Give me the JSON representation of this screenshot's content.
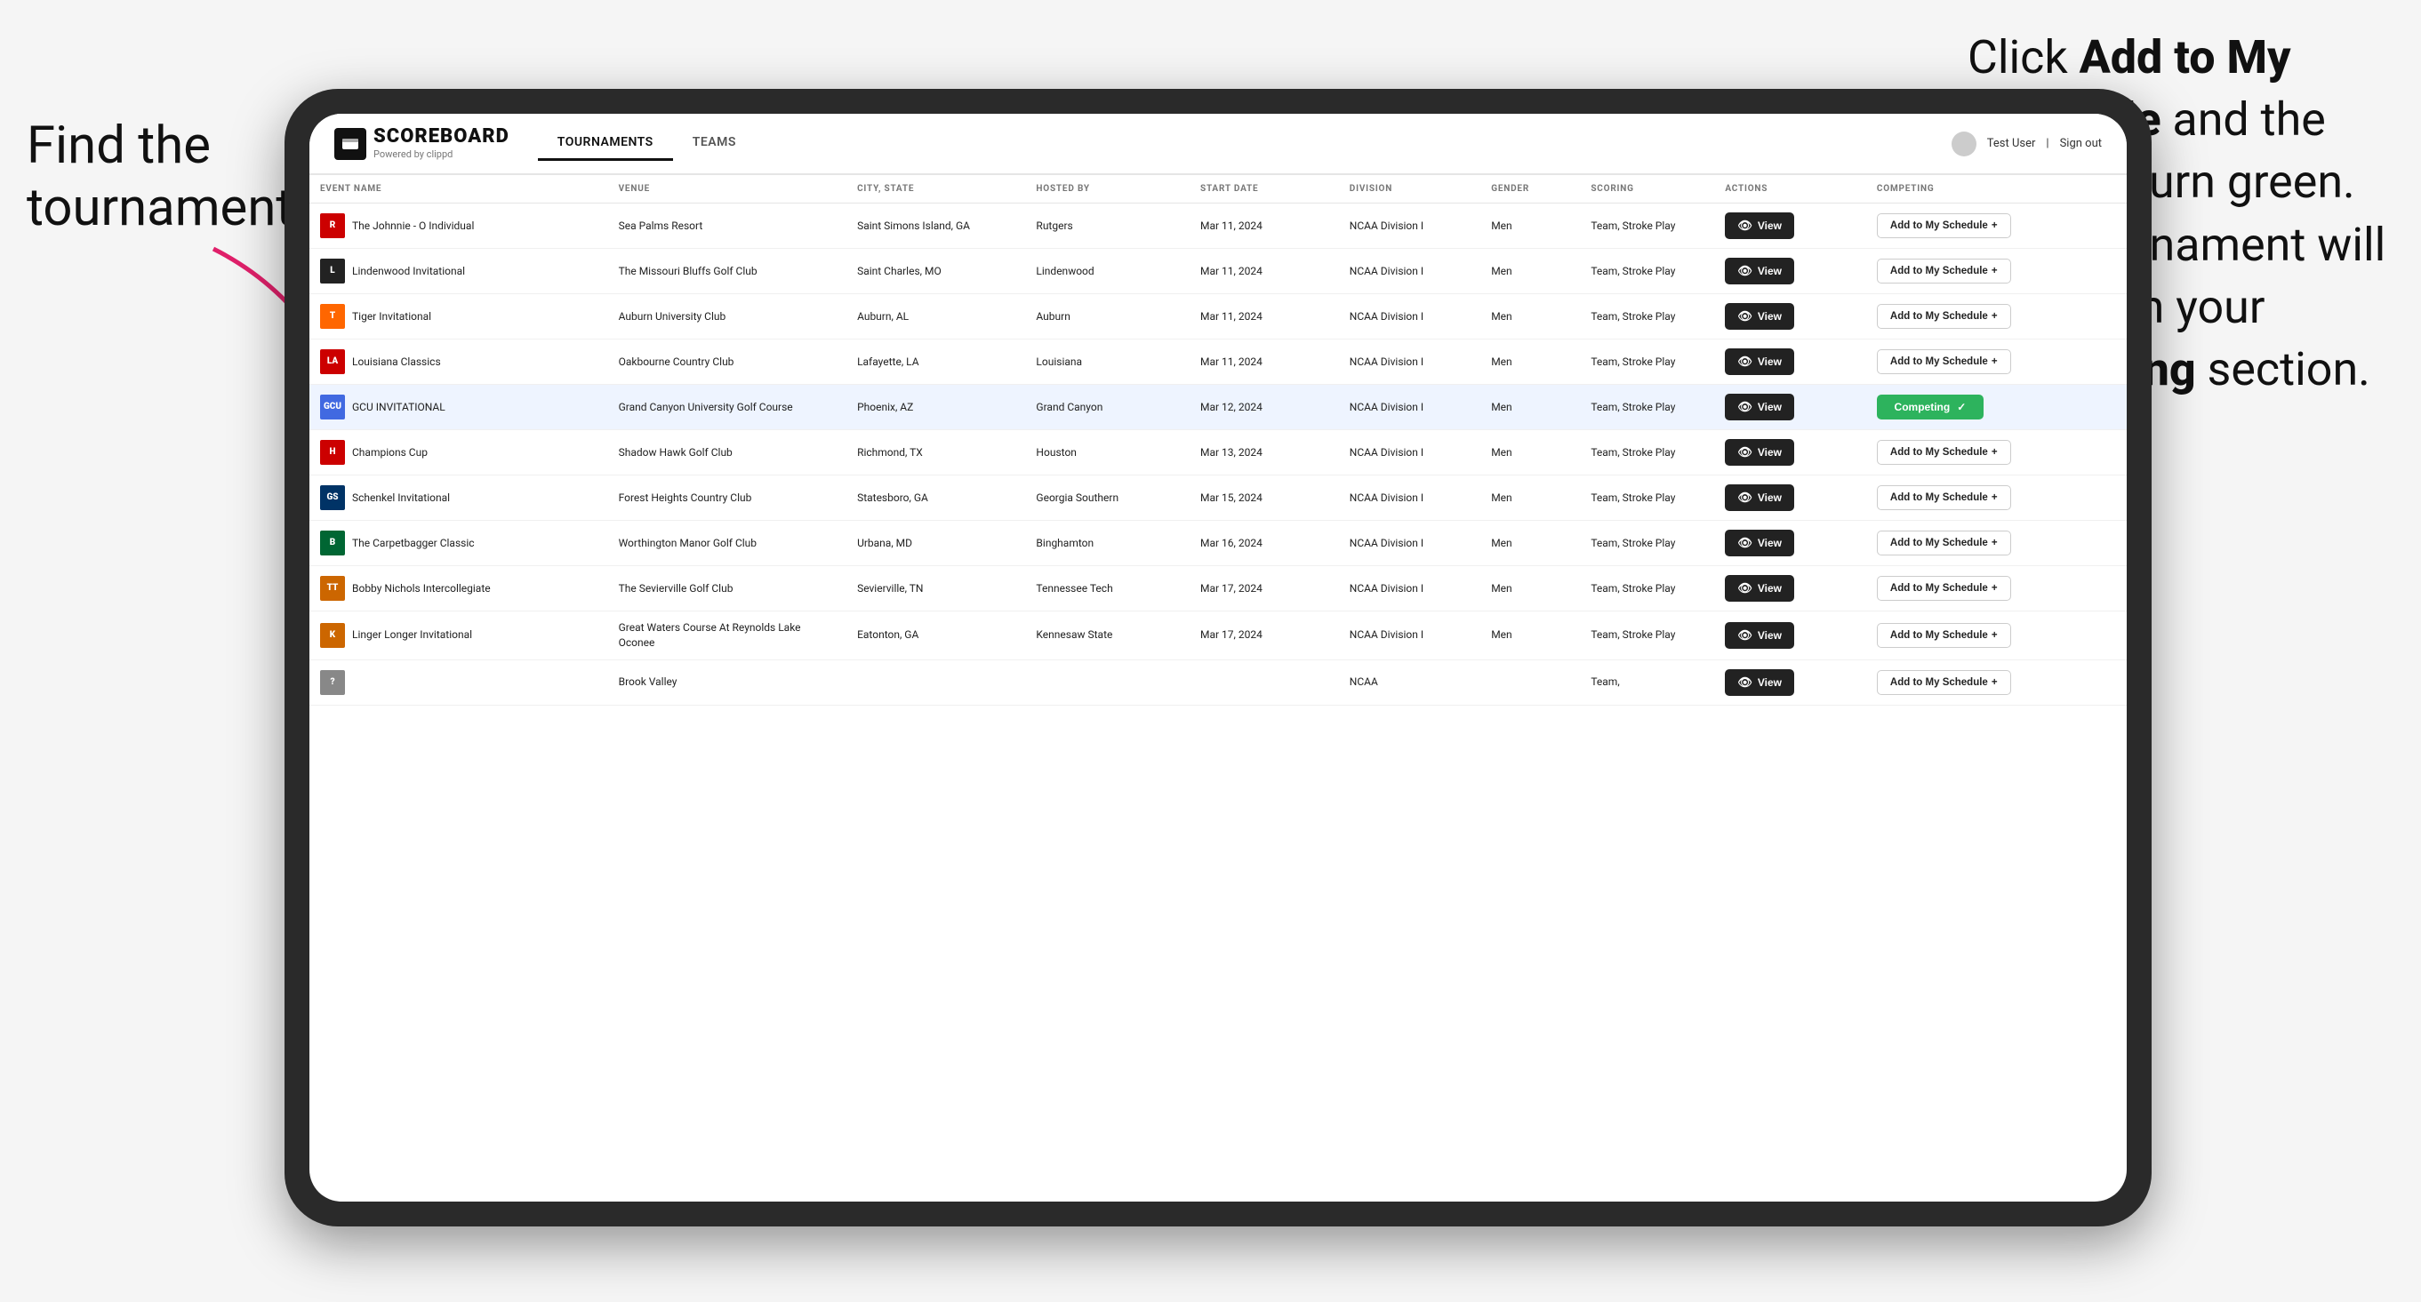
{
  "annotations": {
    "left": "Find the tournament.",
    "right_line1": "Click ",
    "right_bold1": "Add to My Schedule",
    "right_line2": " and the box will turn green. This tournament will now be in your ",
    "right_bold2": "Competing",
    "right_line3": " section."
  },
  "header": {
    "logo_text": "SCOREBOARD",
    "logo_sub": "Powered by clippd",
    "nav_tournaments": "TOURNAMENTS",
    "nav_teams": "TEAMS",
    "user": "Test User",
    "sign_out": "Sign out"
  },
  "table": {
    "columns": [
      "EVENT NAME",
      "VENUE",
      "CITY, STATE",
      "HOSTED BY",
      "START DATE",
      "DIVISION",
      "GENDER",
      "SCORING",
      "ACTIONS",
      "COMPETING"
    ],
    "rows": [
      {
        "logo": "R",
        "logo_color": "#cc0000",
        "event": "The Johnnie - O Individual",
        "venue": "Sea Palms Resort",
        "city": "Saint Simons Island, GA",
        "hosted": "Rutgers",
        "date": "Mar 11, 2024",
        "division": "NCAA Division I",
        "gender": "Men",
        "scoring": "Team, Stroke Play",
        "action": "View",
        "competing": "Add to My Schedule",
        "status": "add"
      },
      {
        "logo": "L",
        "logo_color": "#222222",
        "event": "Lindenwood Invitational",
        "venue": "The Missouri Bluffs Golf Club",
        "city": "Saint Charles, MO",
        "hosted": "Lindenwood",
        "date": "Mar 11, 2024",
        "division": "NCAA Division I",
        "gender": "Men",
        "scoring": "Team, Stroke Play",
        "action": "View",
        "competing": "Add to My Schedule",
        "status": "add"
      },
      {
        "logo": "T",
        "logo_color": "#ff6600",
        "event": "Tiger Invitational",
        "venue": "Auburn University Club",
        "city": "Auburn, AL",
        "hosted": "Auburn",
        "date": "Mar 11, 2024",
        "division": "NCAA Division I",
        "gender": "Men",
        "scoring": "Team, Stroke Play",
        "action": "View",
        "competing": "Add to My Schedule",
        "status": "add"
      },
      {
        "logo": "LA",
        "logo_color": "#cc0000",
        "event": "Louisiana Classics",
        "venue": "Oakbourne Country Club",
        "city": "Lafayette, LA",
        "hosted": "Louisiana",
        "date": "Mar 11, 2024",
        "division": "NCAA Division I",
        "gender": "Men",
        "scoring": "Team, Stroke Play",
        "action": "View",
        "competing": "Add to My Schedule",
        "status": "add"
      },
      {
        "logo": "GCU",
        "logo_color": "#4169e1",
        "event": "GCU INVITATIONAL",
        "venue": "Grand Canyon University Golf Course",
        "city": "Phoenix, AZ",
        "hosted": "Grand Canyon",
        "date": "Mar 12, 2024",
        "division": "NCAA Division I",
        "gender": "Men",
        "scoring": "Team, Stroke Play",
        "action": "View",
        "competing": "Competing",
        "status": "competing",
        "highlighted": true
      },
      {
        "logo": "H",
        "logo_color": "#cc0000",
        "event": "Champions Cup",
        "venue": "Shadow Hawk Golf Club",
        "city": "Richmond, TX",
        "hosted": "Houston",
        "date": "Mar 13, 2024",
        "division": "NCAA Division I",
        "gender": "Men",
        "scoring": "Team, Stroke Play",
        "action": "View",
        "competing": "Add to My Schedule",
        "status": "add"
      },
      {
        "logo": "GS",
        "logo_color": "#003366",
        "event": "Schenkel Invitational",
        "venue": "Forest Heights Country Club",
        "city": "Statesboro, GA",
        "hosted": "Georgia Southern",
        "date": "Mar 15, 2024",
        "division": "NCAA Division I",
        "gender": "Men",
        "scoring": "Team, Stroke Play",
        "action": "View",
        "competing": "Add to My Schedule",
        "status": "add"
      },
      {
        "logo": "B",
        "logo_color": "#006633",
        "event": "The Carpetbagger Classic",
        "venue": "Worthington Manor Golf Club",
        "city": "Urbana, MD",
        "hosted": "Binghamton",
        "date": "Mar 16, 2024",
        "division": "NCAA Division I",
        "gender": "Men",
        "scoring": "Team, Stroke Play",
        "action": "View",
        "competing": "Add to My Schedule",
        "status": "add"
      },
      {
        "logo": "TT",
        "logo_color": "#cc6600",
        "event": "Bobby Nichols Intercollegiate",
        "venue": "The Sevierville Golf Club",
        "city": "Sevierville, TN",
        "hosted": "Tennessee Tech",
        "date": "Mar 17, 2024",
        "division": "NCAA Division I",
        "gender": "Men",
        "scoring": "Team, Stroke Play",
        "action": "View",
        "competing": "Add to My Schedule",
        "status": "add"
      },
      {
        "logo": "K",
        "logo_color": "#cc6600",
        "event": "Linger Longer Invitational",
        "venue": "Great Waters Course At Reynolds Lake Oconee",
        "city": "Eatonton, GA",
        "hosted": "Kennesaw State",
        "date": "Mar 17, 2024",
        "division": "NCAA Division I",
        "gender": "Men",
        "scoring": "Team, Stroke Play",
        "action": "View",
        "competing": "Add to My Schedule",
        "status": "add"
      },
      {
        "logo": "?",
        "logo_color": "#888888",
        "event": "",
        "venue": "Brook Valley",
        "city": "",
        "hosted": "",
        "date": "",
        "division": "NCAA",
        "gender": "",
        "scoring": "Team,",
        "action": "View",
        "competing": "",
        "status": "add"
      }
    ]
  }
}
